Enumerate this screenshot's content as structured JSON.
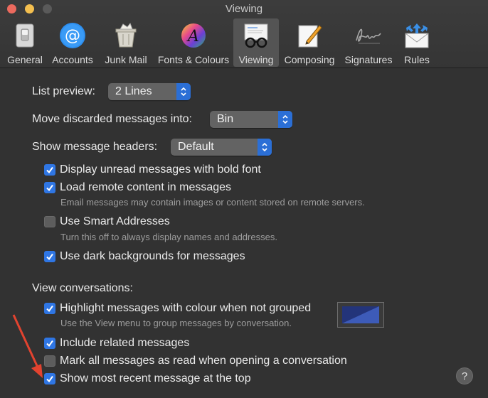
{
  "window": {
    "title": "Viewing"
  },
  "toolbar": {
    "items": [
      {
        "label": "General",
        "icon": "general-switch-icon"
      },
      {
        "label": "Accounts",
        "icon": "at-sign-icon"
      },
      {
        "label": "Junk Mail",
        "icon": "junk-bin-icon"
      },
      {
        "label": "Fonts & Colours",
        "icon": "color-wheel-icon"
      },
      {
        "label": "Viewing",
        "icon": "glasses-icon",
        "active": true
      },
      {
        "label": "Composing",
        "icon": "pencil-note-icon"
      },
      {
        "label": "Signatures",
        "icon": "signature-icon"
      },
      {
        "label": "Rules",
        "icon": "rules-envelope-icon"
      }
    ]
  },
  "settings": {
    "list_preview": {
      "label": "List preview:",
      "value": "2 Lines"
    },
    "move_discarded": {
      "label": "Move discarded messages into:",
      "value": "Bin"
    },
    "show_headers": {
      "label": "Show message headers:",
      "value": "Default"
    },
    "checkboxes": [
      {
        "label": "Display unread messages with bold font",
        "checked": true
      },
      {
        "label": "Load remote content in messages",
        "checked": true,
        "hint": "Email messages may contain images or content stored on remote servers."
      },
      {
        "label": "Use Smart Addresses",
        "checked": false,
        "hint": "Turn this off to always display names and addresses."
      },
      {
        "label": "Use dark backgrounds for messages",
        "checked": true
      }
    ],
    "view_conversations": {
      "label": "View conversations:",
      "checkboxes": [
        {
          "label": "Highlight messages with colour when not grouped",
          "checked": true,
          "hint": "Use the View menu to group messages by conversation."
        },
        {
          "label": "Include related messages",
          "checked": true
        },
        {
          "label": "Mark all messages as read when opening a conversation",
          "checked": false
        },
        {
          "label": "Show most recent message at the top",
          "checked": true
        }
      ],
      "highlight_color": "#2b3f86"
    },
    "help_label": "?"
  },
  "colors": {
    "accent": "#2f76e4",
    "background": "#323232",
    "annotation_arrow": "#e2432f"
  }
}
